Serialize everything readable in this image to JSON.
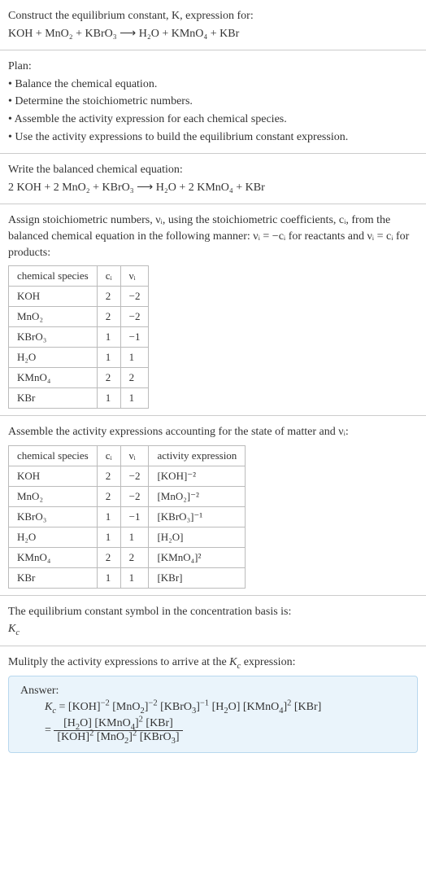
{
  "s1": {
    "l1": "Construct the equilibrium constant, K, expression for:",
    "l2": "KOH + MnO₂ + KBrO₃ ⟶ H₂O + KMnO₄ + KBr"
  },
  "s2": {
    "l1": "Plan:",
    "l2": "• Balance the chemical equation.",
    "l3": "• Determine the stoichiometric numbers.",
    "l4": "• Assemble the activity expression for each chemical species.",
    "l5": "• Use the activity expressions to build the equilibrium constant expression."
  },
  "s3": {
    "l1": "Write the balanced chemical equation:",
    "l2": "2 KOH + 2 MnO₂ + KBrO₃ ⟶ H₂O + 2 KMnO₄ + KBr"
  },
  "s4": {
    "l1": "Assign stoichiometric numbers, νᵢ, using the stoichiometric coefficients, cᵢ, from the balanced chemical equation in the following manner: νᵢ = −cᵢ for reactants and νᵢ = cᵢ for products:",
    "h1": "chemical species",
    "h2": "cᵢ",
    "h3": "νᵢ",
    "rows": [
      {
        "a": "KOH",
        "b": "2",
        "c": "−2"
      },
      {
        "a": "MnO₂",
        "b": "2",
        "c": "−2"
      },
      {
        "a": "KBrO₃",
        "b": "1",
        "c": "−1"
      },
      {
        "a": "H₂O",
        "b": "1",
        "c": "1"
      },
      {
        "a": "KMnO₄",
        "b": "2",
        "c": "2"
      },
      {
        "a": "KBr",
        "b": "1",
        "c": "1"
      }
    ]
  },
  "s5": {
    "l1": "Assemble the activity expressions accounting for the state of matter and νᵢ:",
    "h1": "chemical species",
    "h2": "cᵢ",
    "h3": "νᵢ",
    "h4": "activity expression",
    "rows": [
      {
        "a": "KOH",
        "b": "2",
        "c": "−2",
        "d": "[KOH]⁻²"
      },
      {
        "a": "MnO₂",
        "b": "2",
        "c": "−2",
        "d": "[MnO₂]⁻²"
      },
      {
        "a": "KBrO₃",
        "b": "1",
        "c": "−1",
        "d": "[KBrO₃]⁻¹"
      },
      {
        "a": "H₂O",
        "b": "1",
        "c": "1",
        "d": "[H₂O]"
      },
      {
        "a": "KMnO₄",
        "b": "2",
        "c": "2",
        "d": "[KMnO₄]²"
      },
      {
        "a": "KBr",
        "b": "1",
        "c": "1",
        "d": "[KBr]"
      }
    ]
  },
  "s6": {
    "l1": "The equilibrium constant symbol in the concentration basis is:",
    "l2": "K_c"
  },
  "s7": {
    "l1": "Mulitply the activity expressions to arrive at the K_c expression:"
  },
  "ans": {
    "label": "Answer:",
    "line1": "K_c = [KOH]⁻² [MnO₂]⁻² [KBrO₃]⁻¹ [H₂O] [KMnO₄]² [KBr]",
    "eq": "=",
    "num": "[H₂O] [KMnO₄]² [KBr]",
    "den": "[KOH]² [MnO₂]² [KBrO₃]"
  },
  "chart_data": {
    "type": "table",
    "tables": [
      {
        "title": "Stoichiometric numbers",
        "columns": [
          "chemical species",
          "c_i",
          "ν_i"
        ],
        "rows": [
          [
            "KOH",
            2,
            -2
          ],
          [
            "MnO2",
            2,
            -2
          ],
          [
            "KBrO3",
            1,
            -1
          ],
          [
            "H2O",
            1,
            1
          ],
          [
            "KMnO4",
            2,
            2
          ],
          [
            "KBr",
            1,
            1
          ]
        ]
      },
      {
        "title": "Activity expressions",
        "columns": [
          "chemical species",
          "c_i",
          "ν_i",
          "activity expression"
        ],
        "rows": [
          [
            "KOH",
            2,
            -2,
            "[KOH]^-2"
          ],
          [
            "MnO2",
            2,
            -2,
            "[MnO2]^-2"
          ],
          [
            "KBrO3",
            1,
            -1,
            "[KBrO3]^-1"
          ],
          [
            "H2O",
            1,
            1,
            "[H2O]"
          ],
          [
            "KMnO4",
            2,
            2,
            "[KMnO4]^2"
          ],
          [
            "KBr",
            1,
            1,
            "[KBr]"
          ]
        ]
      }
    ]
  }
}
